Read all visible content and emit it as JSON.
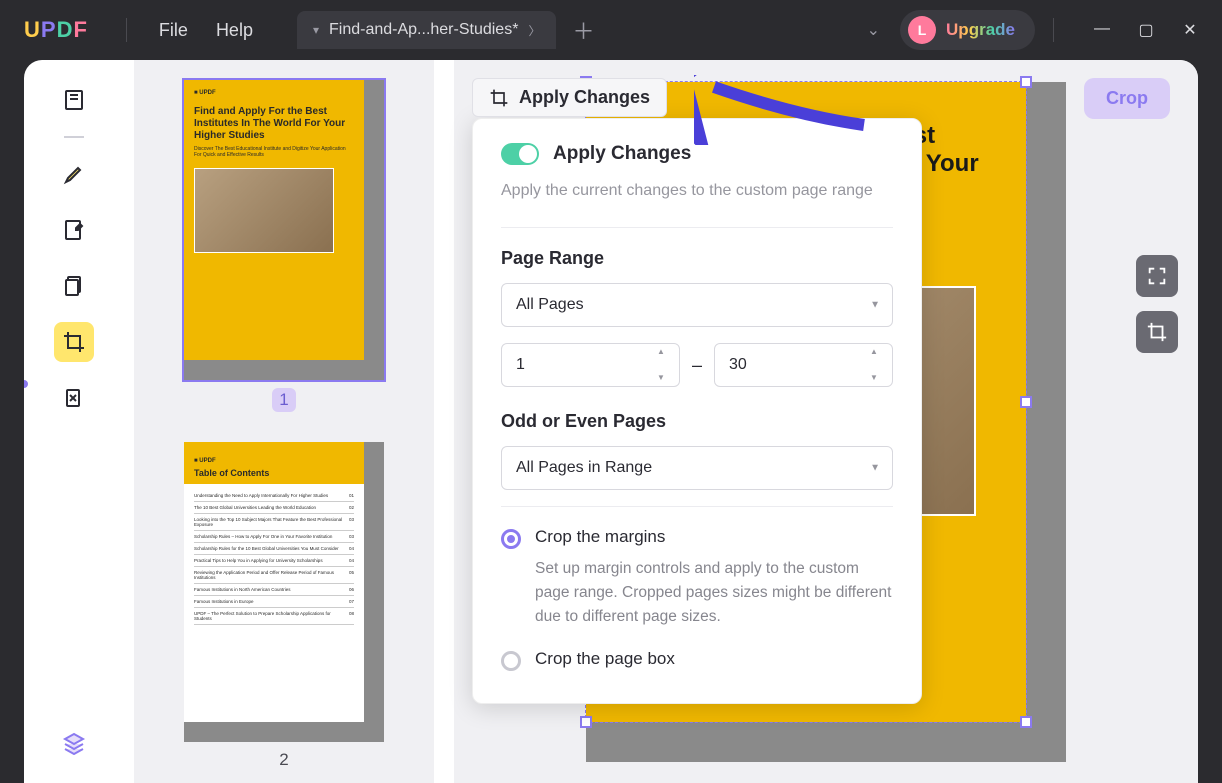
{
  "titlebar": {
    "menu_file": "File",
    "menu_help": "Help",
    "tab_title": "Find-and-Ap...her-Studies*",
    "avatar_letter": "L",
    "upgrade": "Upgrade"
  },
  "toolbar": {
    "apply_changes_btn": "Apply Changes",
    "crop_btn": "Crop"
  },
  "panel": {
    "title": "Apply Changes",
    "desc": "Apply the current changes to the custom page range",
    "page_range_label": "Page Range",
    "page_range_select": "All Pages",
    "range_from": "1",
    "range_to": "30",
    "odd_even_label": "Odd or Even Pages",
    "odd_even_select": "All Pages in Range",
    "radio_margins_label": "Crop the margins",
    "radio_margins_desc": "Set up margin controls and apply to the custom page range. Cropped pages sizes might be different due to different page sizes.",
    "radio_pagebox_label": "Crop the page box"
  },
  "thumbs": {
    "page1_num": "1",
    "page2_num": "2",
    "page1_title": "Find and Apply For the Best Institutes In The World For Your Higher Studies",
    "page1_sub": "Discover The Best Educational Institute and Digitize Your Application For Quick and Effective Results",
    "logo_mark": "■ UPDF",
    "toc_title": "Table of Contents",
    "toc_items": [
      "Understanding the Need to Apply Internationally For Higher Studies",
      "The 10 Best Global Universities Leading the World Education",
      "Looking into the Top 10 Subject Majors That Feature the Best Professional Exposure",
      "Scholarship Rules – How to Apply For One in Your Favorite Institution",
      "Scholarship Rules for the 10 Best Global Universities You Must Consider",
      "Practical Tips to Help You in Applying for University Scholarships",
      "Reviewing the Application Period and Offer Release Period of Famous Institutions",
      "Famous Institutions in North American Countries",
      "Famous Institutions in Europe",
      "UPDF – The Perfect Solution to Prepare Scholarship Applications for Students"
    ],
    "toc_pages": [
      "01",
      "02",
      "03",
      "03",
      "04",
      "04",
      "05",
      "06",
      "07",
      "08"
    ]
  },
  "doc": {
    "title": "Find and Apply For the Best Institutes In The World For Your Higher Studies",
    "sub": "Discover The Best Educational Institute and Digitize Your Application For Quick and Effective Results"
  }
}
